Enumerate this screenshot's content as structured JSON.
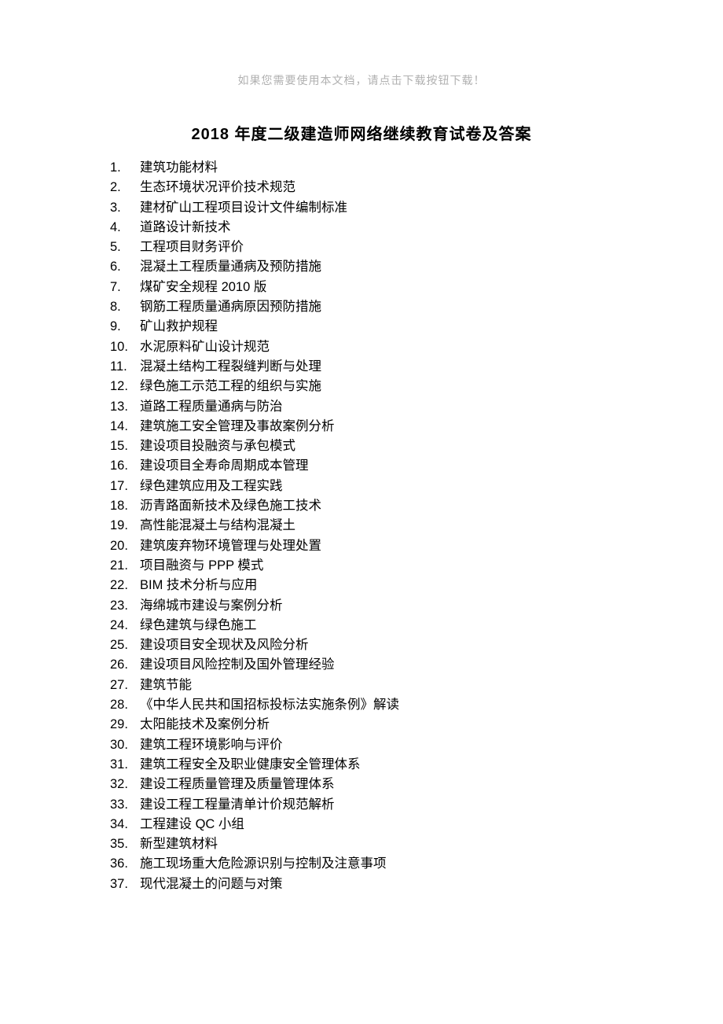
{
  "header_note": "如果您需要使用本文档，请点击下载按钮下载！",
  "title": "2018 年度二级建造师网络继续教育试卷及答案",
  "items": [
    "建筑功能材料",
    "生态环境状况评价技术规范",
    "建材矿山工程项目设计文件编制标准",
    "道路设计新技术",
    "工程项目财务评价",
    "混凝土工程质量通病及预防措施",
    "煤矿安全规程 2010 版",
    "钢筋工程质量通病原因预防措施",
    "矿山救护规程",
    "水泥原料矿山设计规范",
    "混凝土结构工程裂缝判断与处理",
    "绿色施工示范工程的组织与实施",
    "道路工程质量通病与防治",
    "建筑施工安全管理及事故案例分析",
    "建设项目投融资与承包模式",
    "建设项目全寿命周期成本管理",
    "绿色建筑应用及工程实践",
    "沥青路面新技术及绿色施工技术",
    "高性能混凝土与结构混凝土",
    "建筑废弃物环境管理与处理处置",
    "项目融资与 PPP 模式",
    "BIM 技术分析与应用",
    "海绵城市建设与案例分析",
    "绿色建筑与绿色施工",
    "建设项目安全现状及风险分析",
    "建设项目风险控制及国外管理经验",
    "建筑节能",
    "《中华人民共和国招标投标法实施条例》解读",
    "太阳能技术及案例分析",
    "建筑工程环境影响与评价",
    "建筑工程安全及职业健康安全管理体系",
    "建设工程质量管理及质量管理体系",
    "建设工程工程量清单计价规范解析",
    "工程建设 QC 小组",
    "新型建筑材料",
    "施工现场重大危险源识别与控制及注意事项",
    "现代混凝土的问题与对策"
  ]
}
